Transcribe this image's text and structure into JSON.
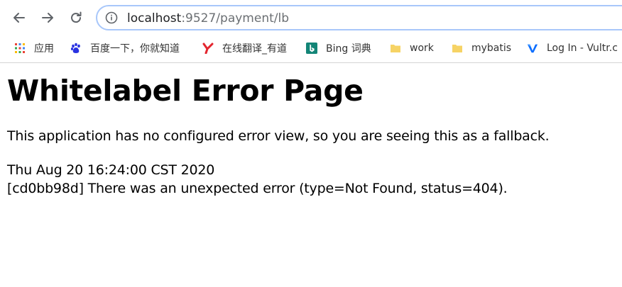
{
  "browser": {
    "url_host": "localhost",
    "url_rest": ":9527/payment/lb",
    "icons": {
      "back": "back-arrow-icon",
      "forward": "forward-arrow-icon",
      "reload": "reload-icon",
      "site_info": "info-icon"
    }
  },
  "bookmarks": {
    "items": [
      {
        "label": "应用",
        "icon": "apps-grid-icon"
      },
      {
        "label": "百度一下，你就知道",
        "icon": "baidu-paw-icon"
      },
      {
        "label": "在线翻译_有道",
        "icon": "youdao-icon"
      },
      {
        "label": "Bing 词典",
        "icon": "bing-icon"
      },
      {
        "label": "work",
        "icon": "folder-icon"
      },
      {
        "label": "mybatis",
        "icon": "folder-icon"
      },
      {
        "label": "Log In - Vultr.c",
        "icon": "vultr-icon"
      }
    ]
  },
  "page": {
    "title": "Whitelabel Error Page",
    "message": "This application has no configured error view, so you are seeing this as a fallback.",
    "timestamp": "Thu Aug 20 16:24:00 CST 2020",
    "error": "[cd0bb98d] There was an unexpected error (type=Not Found, status=404)."
  },
  "colors": {
    "omnibox_border": "#a8c7fa",
    "folder": "#f6d365",
    "bing": "#138577",
    "youdao": "#e3252e",
    "vultr": "#0a6dff"
  }
}
